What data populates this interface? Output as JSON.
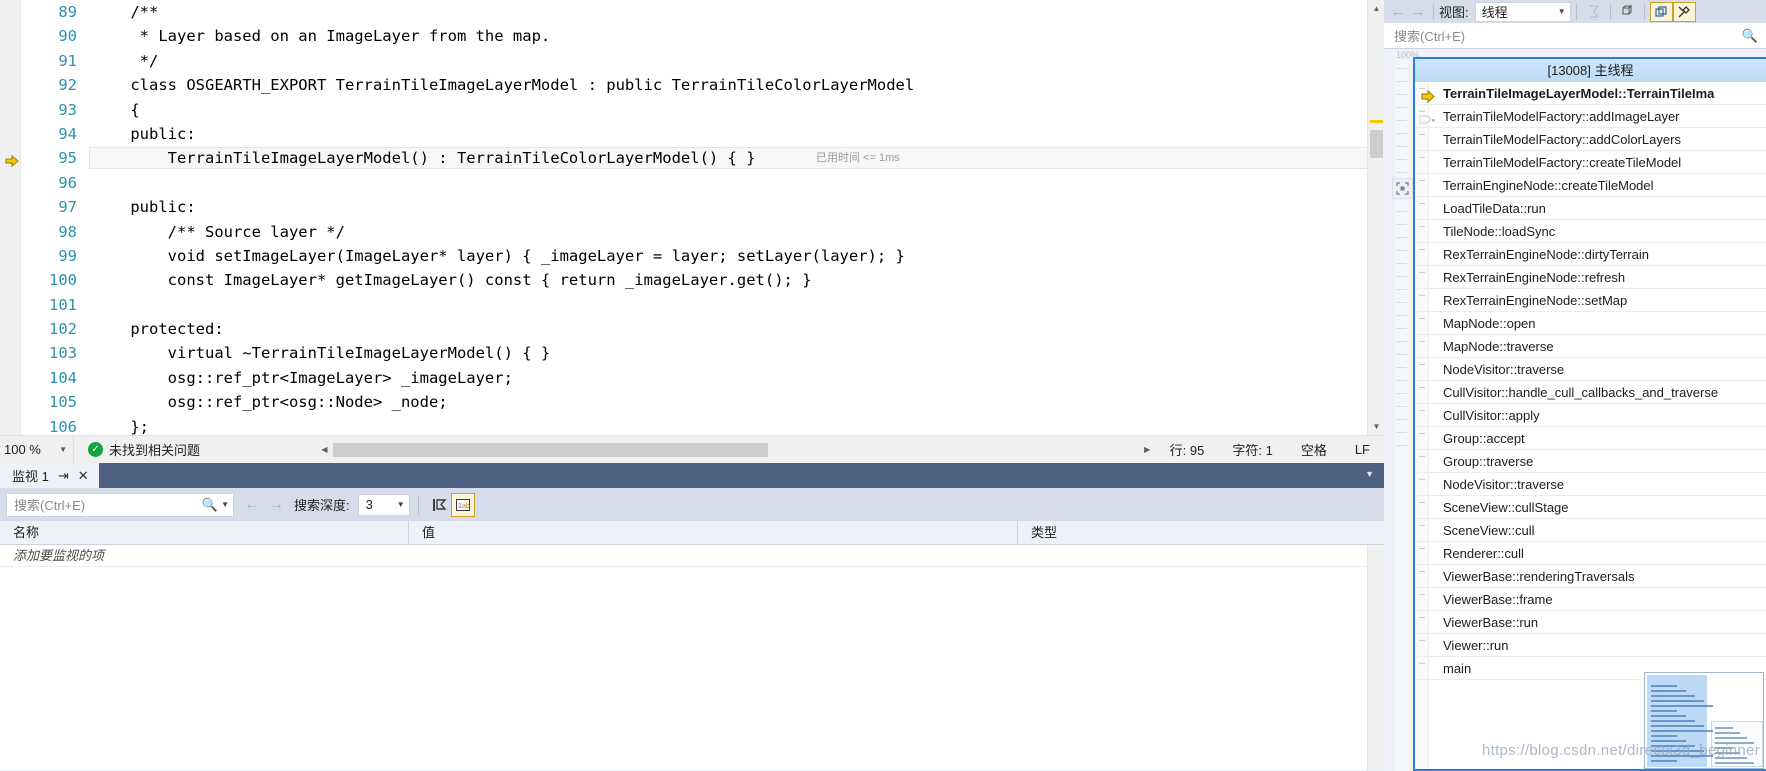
{
  "editor": {
    "lines": [
      {
        "num": "89",
        "text": "    /**"
      },
      {
        "num": "90",
        "text": "     * Layer based on an ImageLayer from the map."
      },
      {
        "num": "91",
        "text": "     */"
      },
      {
        "num": "92",
        "text": "    class OSGEARTH_EXPORT TerrainTileImageLayerModel : public TerrainTileColorLayerModel"
      },
      {
        "num": "93",
        "text": "    {"
      },
      {
        "num": "94",
        "text": "    public:"
      },
      {
        "num": "95",
        "text": "        TerrainTileImageLayerModel() : TerrainTileColorLayerModel() { }"
      },
      {
        "num": "96",
        "text": ""
      },
      {
        "num": "97",
        "text": "    public:"
      },
      {
        "num": "98",
        "text": "        /** Source layer */"
      },
      {
        "num": "99",
        "text": "        void setImageLayer(ImageLayer* layer) { _imageLayer = layer; setLayer(layer); }"
      },
      {
        "num": "100",
        "text": "        const ImageLayer* getImageLayer() const { return _imageLayer.get(); }"
      },
      {
        "num": "101",
        "text": ""
      },
      {
        "num": "102",
        "text": "    protected:"
      },
      {
        "num": "103",
        "text": "        virtual ~TerrainTileImageLayerModel() { }"
      },
      {
        "num": "104",
        "text": "        osg::ref_ptr<ImageLayer> _imageLayer;"
      },
      {
        "num": "105",
        "text": "        osg::ref_ptr<osg::Node> _node;"
      },
      {
        "num": "106",
        "text": "    };"
      }
    ],
    "current_line_index": 6,
    "inline_hint": "已用时间 <= 1ms",
    "status": {
      "zoom": "100 %",
      "issues": "未找到相关问题",
      "line": "行: 95",
      "char": "字符: 1",
      "spaces": "空格",
      "eol": "LF"
    }
  },
  "watch": {
    "tab_label": "监视 1",
    "search_placeholder": "搜索(Ctrl+E)",
    "depth_label": "搜索深度:",
    "depth_value": "3",
    "columns": [
      "名称",
      "值",
      "类型"
    ],
    "placeholder_row": "添加要监视的项",
    "icons": {
      "pin": "pin-icon",
      "close": "close-icon",
      "search": "search-icon",
      "prev": "back-arrow-icon",
      "next": "forward-arrow-icon",
      "filter": "filter-pin-icon",
      "hex": "hex-display-icon"
    }
  },
  "callstack": {
    "toolbar": {
      "back": "back-arrow-icon",
      "forward": "forward-arrow-icon",
      "view_label": "视图:",
      "view_value": "线程",
      "flag_icon": "flag-icon",
      "cube_icon": "cube-icon",
      "external_code_icon": "show-external-code-icon",
      "tools_icon": "tools-icon"
    },
    "search_placeholder": "搜索(Ctrl+E)",
    "zoom_label": "100%",
    "thread_header": "[13008] 主线程",
    "frames": [
      {
        "label": "TerrainTileImageLayerModel::TerrainTileIma",
        "active": true,
        "marker": "yellow-arrow"
      },
      {
        "label": "TerrainTileModelFactory::addImageLayer",
        "active": false,
        "marker": "gray-arrow"
      },
      {
        "label": "TerrainTileModelFactory::addColorLayers",
        "active": false,
        "marker": ""
      },
      {
        "label": "TerrainTileModelFactory::createTileModel",
        "active": false,
        "marker": ""
      },
      {
        "label": "TerrainEngineNode::createTileModel",
        "active": false,
        "marker": ""
      },
      {
        "label": "LoadTileData::run",
        "active": false,
        "marker": ""
      },
      {
        "label": "TileNode::loadSync",
        "active": false,
        "marker": ""
      },
      {
        "label": "RexTerrainEngineNode::dirtyTerrain",
        "active": false,
        "marker": ""
      },
      {
        "label": "RexTerrainEngineNode::refresh",
        "active": false,
        "marker": ""
      },
      {
        "label": "RexTerrainEngineNode::setMap",
        "active": false,
        "marker": ""
      },
      {
        "label": "MapNode::open",
        "active": false,
        "marker": ""
      },
      {
        "label": "MapNode::traverse",
        "active": false,
        "marker": ""
      },
      {
        "label": "NodeVisitor::traverse",
        "active": false,
        "marker": ""
      },
      {
        "label": "CullVisitor::handle_cull_callbacks_and_traverse",
        "active": false,
        "marker": ""
      },
      {
        "label": "CullVisitor::apply",
        "active": false,
        "marker": ""
      },
      {
        "label": "Group::accept",
        "active": false,
        "marker": ""
      },
      {
        "label": "Group::traverse",
        "active": false,
        "marker": ""
      },
      {
        "label": "NodeVisitor::traverse",
        "active": false,
        "marker": ""
      },
      {
        "label": "SceneView::cullStage",
        "active": false,
        "marker": ""
      },
      {
        "label": "SceneView::cull",
        "active": false,
        "marker": ""
      },
      {
        "label": "Renderer::cull",
        "active": false,
        "marker": ""
      },
      {
        "label": "ViewerBase::renderingTraversals",
        "active": false,
        "marker": ""
      },
      {
        "label": "ViewerBase::frame",
        "active": false,
        "marker": ""
      },
      {
        "label": "ViewerBase::run",
        "active": false,
        "marker": ""
      },
      {
        "label": "Viewer::run",
        "active": false,
        "marker": ""
      },
      {
        "label": "main",
        "active": false,
        "marker": ""
      }
    ]
  },
  "watermark": "https://blog.csdn.net/directx3d_beginner",
  "colors": {
    "accent_blue": "#2a7fd4",
    "tab_strip": "#4d6082",
    "toolbar": "#d7dcea",
    "panel_bg": "#eef1f8",
    "line_number": "#2b91af",
    "ok_green": "#14a341",
    "arrow_yellow": "#f0c808"
  }
}
